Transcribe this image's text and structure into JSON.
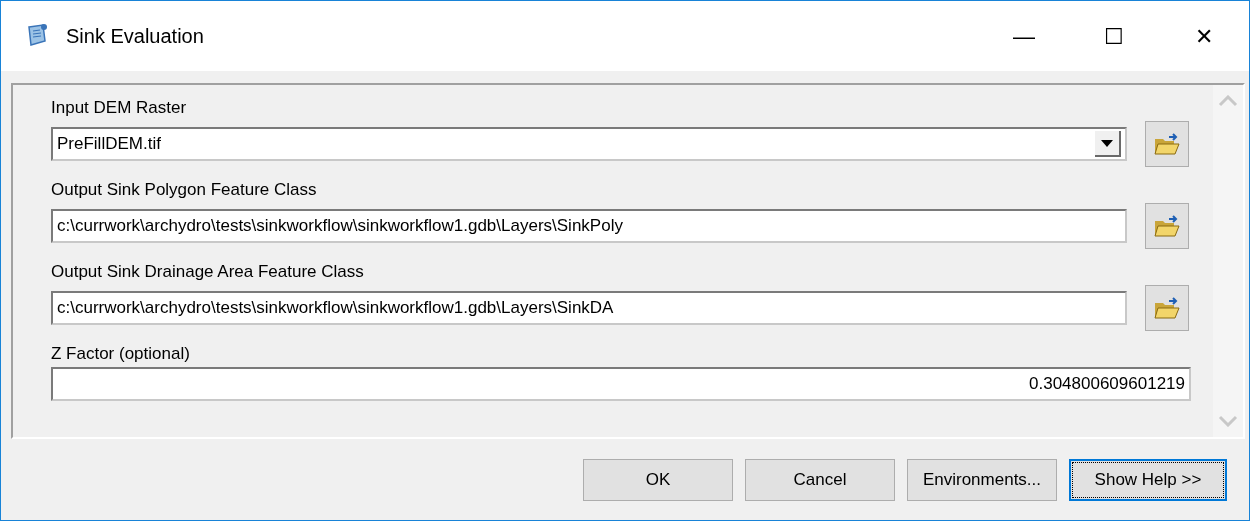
{
  "window": {
    "title": "Sink Evaluation",
    "controls": [
      "—",
      "☐",
      "✕"
    ]
  },
  "parameters": [
    {
      "kind": "dropdown",
      "label": "Input DEM Raster",
      "value": "PreFillDEM.tif",
      "browse": true
    },
    {
      "kind": "text",
      "label": "Output Sink Polygon Feature Class",
      "value": "c:\\currwork\\archydro\\tests\\sinkworkflow\\sinkworkflow1.gdb\\Layers\\SinkPoly",
      "browse": true
    },
    {
      "kind": "text",
      "label": "Output Sink Drainage Area Feature Class",
      "value": "c:\\currwork\\archydro\\tests\\sinkworkflow\\sinkworkflow1.gdb\\Layers\\SinkDA",
      "browse": true
    },
    {
      "kind": "number",
      "label": "Z Factor (optional)",
      "value": "0.304800609601219",
      "browse": false
    }
  ],
  "buttons": [
    {
      "label": "OK",
      "focused": false
    },
    {
      "label": "Cancel",
      "focused": false
    },
    {
      "label": "Environments...",
      "focused": false
    },
    {
      "label": "Show Help >>",
      "focused": true
    }
  ]
}
